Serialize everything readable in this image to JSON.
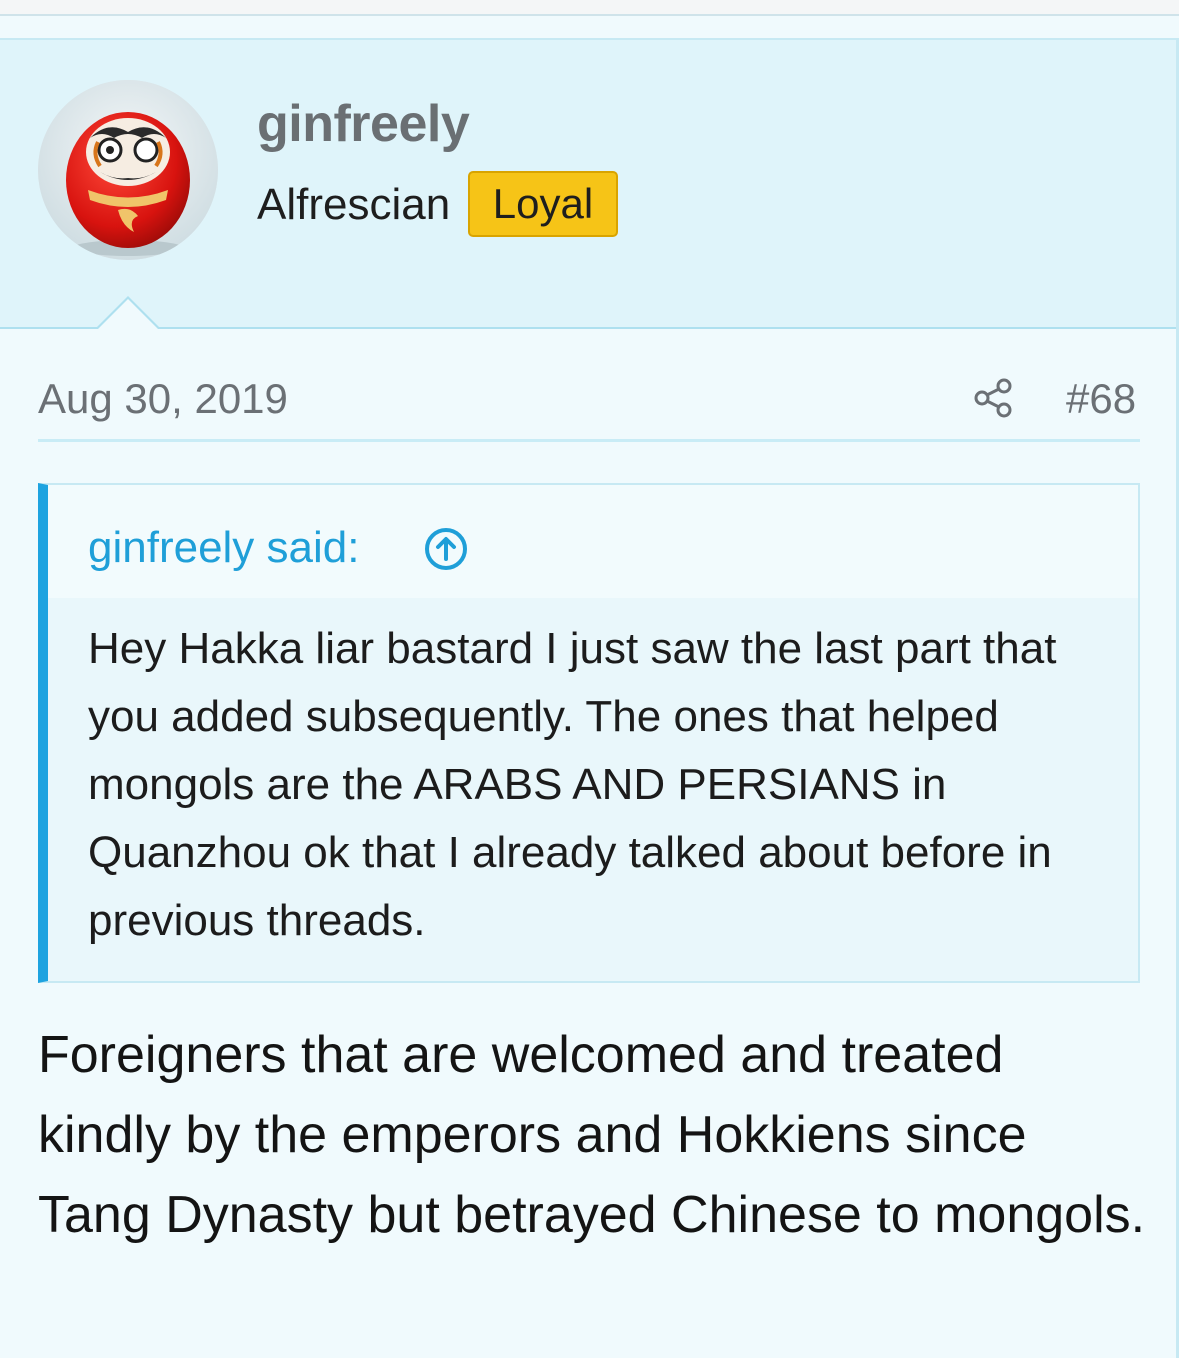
{
  "user": {
    "name": "ginfreely",
    "title": "Alfrescian",
    "badge": "Loyal",
    "avatar_icon": "daruma-doll-avatar"
  },
  "post": {
    "date": "Aug 30, 2019",
    "number": "#68",
    "share_icon": "share-icon",
    "quote": {
      "author_line": "ginfreely said:",
      "jump_icon": "arrow-up-circle-icon",
      "text": "Hey Hakka liar bastard I just saw the last part that you added subsequently. The ones that helped mongols are the ARABS AND PERSIANS in Quanzhou ok that I already talked about before in previous threads."
    },
    "body": "Foreigners that are welcomed and treated kindly by the emperors and Hokkiens since Tang Dynasty but betrayed Chinese to mongols."
  },
  "colors": {
    "header_bg": "#dff4fa",
    "quote_accent": "#1ea3e0",
    "badge_bg": "#f6c417",
    "link": "#1f9fd8"
  }
}
